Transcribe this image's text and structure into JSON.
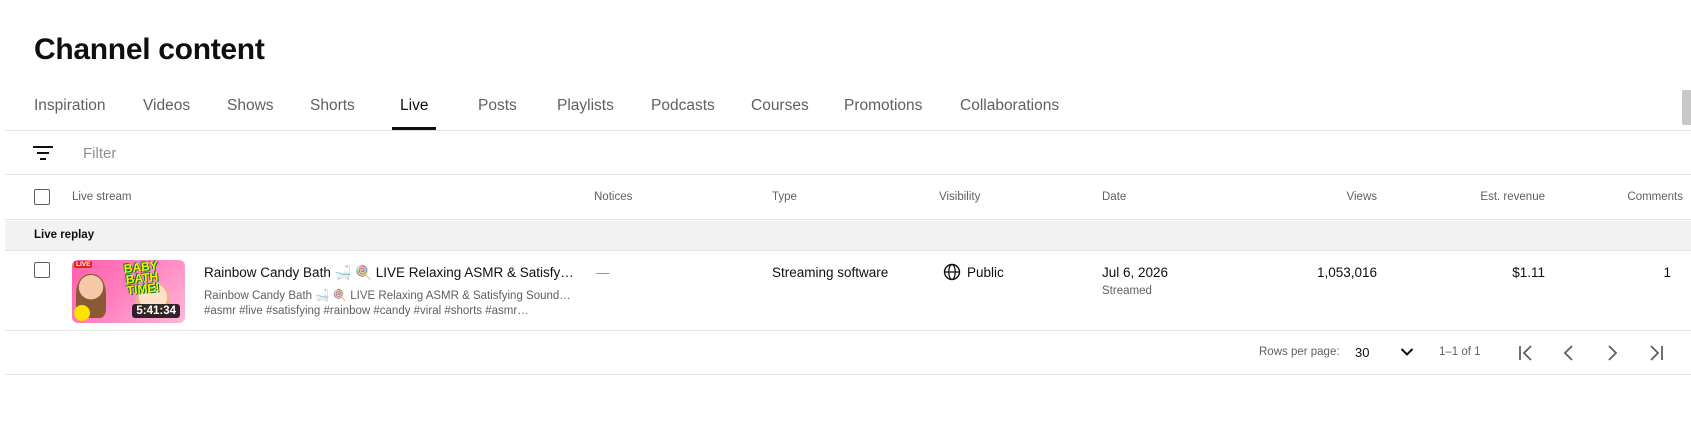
{
  "page": {
    "title": "Channel content"
  },
  "tabs": [
    {
      "label": "Inspiration"
    },
    {
      "label": "Videos"
    },
    {
      "label": "Shows"
    },
    {
      "label": "Shorts"
    },
    {
      "label": "Live",
      "active": true
    },
    {
      "label": "Posts"
    },
    {
      "label": "Playlists"
    },
    {
      "label": "Podcasts"
    },
    {
      "label": "Courses"
    },
    {
      "label": "Promotions"
    },
    {
      "label": "Collaborations"
    }
  ],
  "filter": {
    "placeholder": "Filter",
    "icon": "filter-icon"
  },
  "columns": {
    "live_stream": "Live stream",
    "notices": "Notices",
    "type": "Type",
    "visibility": "Visibility",
    "date": "Date",
    "views": "Views",
    "est_revenue": "Est. revenue",
    "comments": "Comments"
  },
  "group": {
    "label": "Live replay"
  },
  "rows": [
    {
      "thumbnail": {
        "duration": "5:41:34",
        "live_badge": "LIVE",
        "text": "BABY BATH TIME!"
      },
      "title": "Rainbow Candy Bath 🛁 🍭 LIVE Relaxing ASMR & Satisfying Sounds ✨",
      "description_line1": "Rainbow Candy Bath 🛁 🍭 LIVE Relaxing ASMR & Satisfying Sounds ✨",
      "description_line2": "#asmr #live #satisfying #rainbow #candy #viral #shorts #asmr…",
      "notices": "—",
      "type": "Streaming software",
      "visibility": "Public",
      "visibility_icon": "globe-icon",
      "date": "Jul 6, 2026",
      "date_sub": "Streamed",
      "views": "1,053,016",
      "est_revenue": "$1.11",
      "comments": "1"
    }
  ],
  "pagination": {
    "rows_per_page_label": "Rows per page:",
    "rows_per_page_value": "30",
    "range": "1–1 of 1"
  },
  "colors": {
    "text_primary": "#0f0f0f",
    "text_secondary": "#606060",
    "divider": "#e5e5e5",
    "group_bg": "#f2f2f2"
  }
}
